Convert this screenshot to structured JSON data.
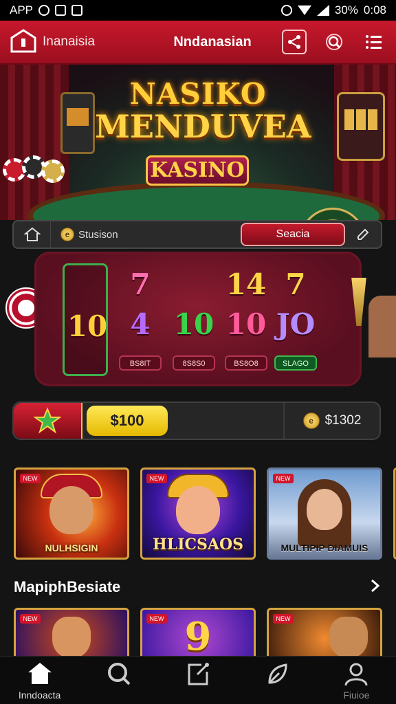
{
  "status_bar": {
    "left_text": "APP",
    "battery": "30%",
    "time": "0:08"
  },
  "app_bar": {
    "brand": "Inanaisia",
    "title": "Nndanasian"
  },
  "hero": {
    "line1": "NASIKO",
    "line2": "MENDUVEA",
    "badge": "KASINO"
  },
  "filter_bar": {
    "filter_label": "Stusison",
    "filter_coin": "e",
    "search_label": "Seacia"
  },
  "slot_reels": [
    {
      "top": "",
      "mid": "10",
      "label": "",
      "top_color": "#ffffff",
      "mid_color": "#ffcf3a",
      "active": true
    },
    {
      "top": "7",
      "mid": "4",
      "label": "BS8IT",
      "top_color": "#ff6fb0",
      "mid_color": "#b46cff",
      "active": false
    },
    {
      "top": "",
      "mid": "10",
      "label": "8S8S0",
      "top_color": "#8ce8ff",
      "mid_color": "#39d24a",
      "active": false
    },
    {
      "top": "14",
      "mid": "10",
      "label": "BS8O8",
      "top_color": "#ffd447",
      "mid_color": "#ff5a9a",
      "active": false
    },
    {
      "top": "7",
      "mid": "JO",
      "label": "SLAGO",
      "top_color": "#ffd447",
      "mid_color": "#b48cff",
      "active": false
    }
  ],
  "balance": {
    "amount": "$100",
    "secondary": "$1302",
    "coin": "e"
  },
  "featured_games": [
    {
      "tag": "NEW",
      "title": "NULHSIGIN"
    },
    {
      "tag": "NEW",
      "title": "HLICSAOS"
    },
    {
      "tag": "NEW",
      "title": "MULTIPIP DIAMUIS"
    }
  ],
  "section": {
    "title": "MapiphBesiate"
  },
  "more_games": [
    {
      "tag": "NEW",
      "badge": ""
    },
    {
      "tag": "NEW",
      "badge": "9"
    },
    {
      "tag": "NEW",
      "badge": ""
    }
  ],
  "bottom_nav": [
    {
      "label": "Inndoacta",
      "icon": "home-icon"
    },
    {
      "label": "",
      "icon": "search-icon"
    },
    {
      "label": "",
      "icon": "share-icon"
    },
    {
      "label": "",
      "icon": "leaf-icon"
    },
    {
      "label": "Fiuioe",
      "icon": "profile-icon"
    }
  ],
  "colors": {
    "primary_red": "#c8182c",
    "gold": "#ffd447",
    "background": "#141414"
  }
}
